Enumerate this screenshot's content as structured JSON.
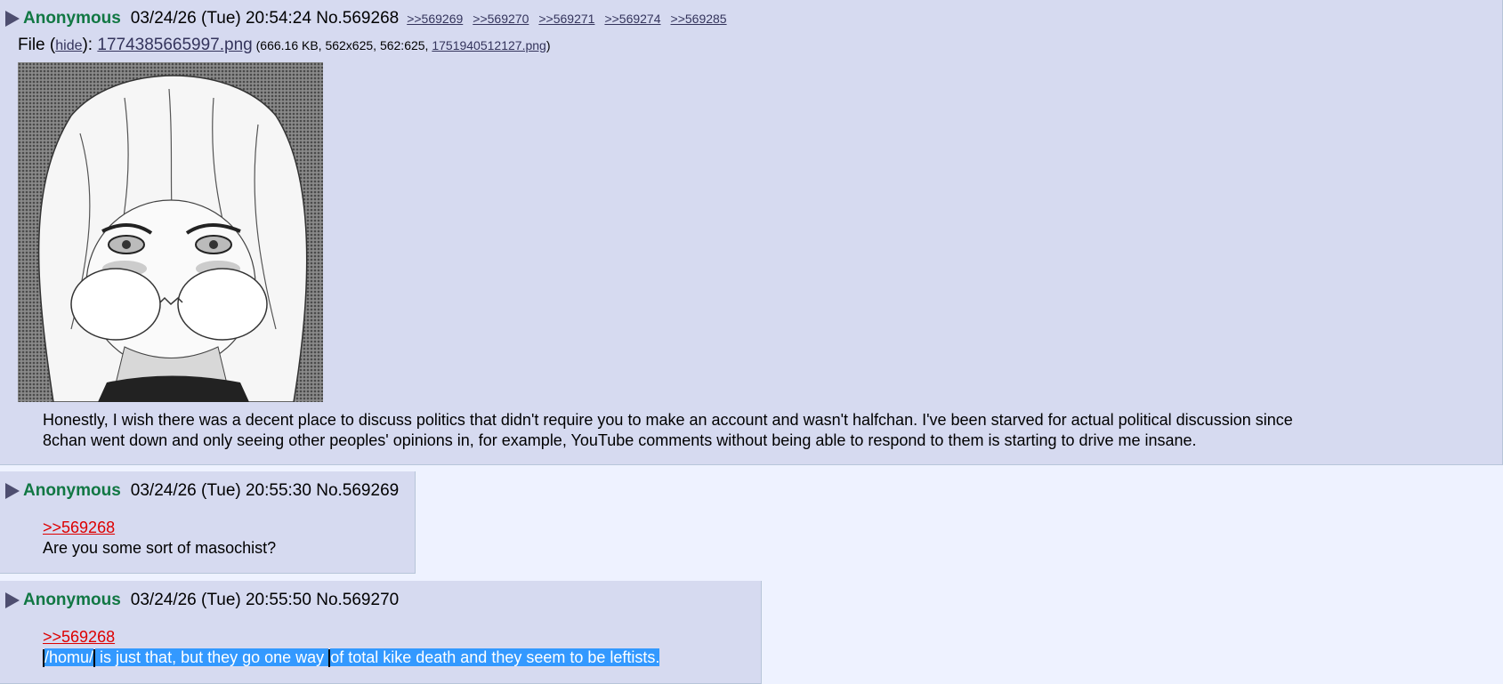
{
  "posts": [
    {
      "name": "Anonymous",
      "datetime": "03/24/26 (Tue) 20:54:24",
      "postno": "No.569268",
      "backlinks": [
        ">>569269",
        ">>569270",
        ">>569271",
        ">>569274",
        ">>569285"
      ],
      "file": {
        "label": "File (",
        "hide": "hide",
        "sep": "): ",
        "filename": "1774385665997.png",
        "meta_open": " (666.16 KB, 562x625, 562:625, ",
        "original": "1751940512127.png",
        "meta_close": ")"
      },
      "body": [
        "Honestly, I wish there was a decent place to discuss politics that didn't require you to make an account and wasn't halfchan. I've been starved for actual political discussion since",
        "8chan went down and only seeing other peoples' opinions in, for example, YouTube comments without being able to respond to them is starting to drive me insane."
      ]
    },
    {
      "name": "Anonymous",
      "datetime": "03/24/26 (Tue) 20:55:30",
      "postno": "No.569269",
      "quote": ">>569268",
      "body": "Are you some sort of masochist?"
    },
    {
      "name": "Anonymous",
      "datetime": "03/24/26 (Tue) 20:55:50",
      "postno": "No.569270",
      "quote": ">>569268",
      "body_part1": "/homu/",
      "body_part2": " is just that, but they go one way ",
      "body_part3": "of total kike death and they seem to be leftists."
    }
  ],
  "colors": {
    "background": "#eef2ff",
    "post_bg": "#d6daf0",
    "name": "#117743",
    "link": "#34345c",
    "quotelink": "#dd0000",
    "selection": "#3399ff"
  }
}
